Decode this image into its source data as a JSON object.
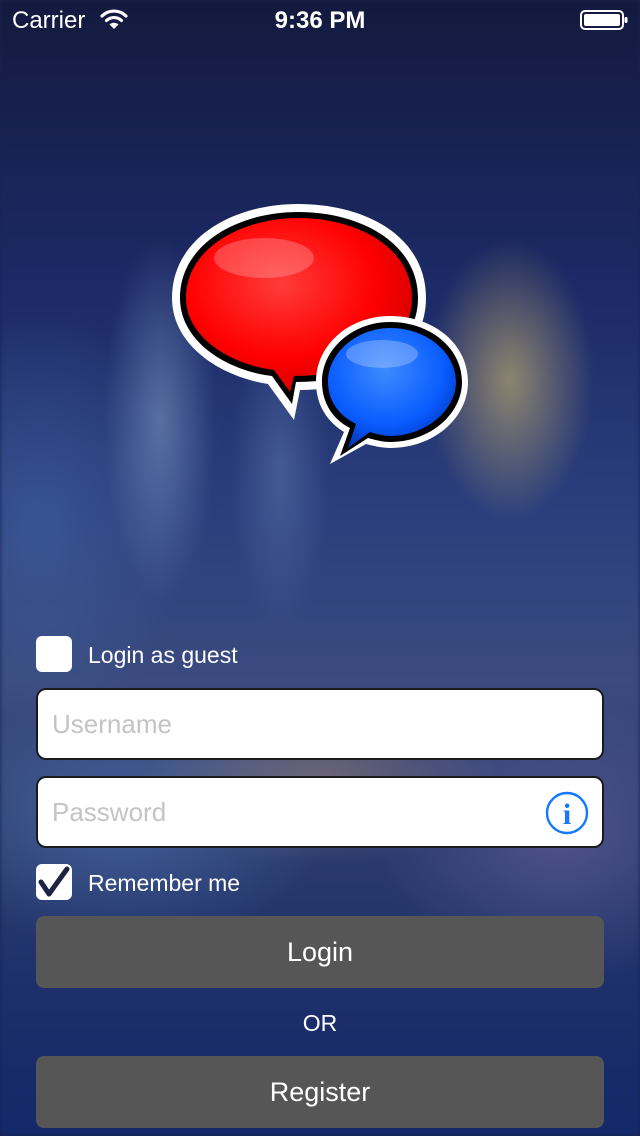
{
  "status_bar": {
    "carrier": "Carrier",
    "time": "9:36 PM",
    "wifi_icon": "wifi-icon",
    "battery_icon": "battery-icon"
  },
  "logo": {
    "icon": "chat-bubbles-icon",
    "colors": {
      "red_bubble": "#ff0000",
      "blue_bubble": "#0a5cff"
    }
  },
  "guest": {
    "label": "Login as guest",
    "checked": false
  },
  "username": {
    "value": "",
    "placeholder": "Username"
  },
  "password": {
    "value": "",
    "placeholder": "Password",
    "info_icon": "info-icon",
    "info_color": "#1479ff"
  },
  "remember": {
    "label": "Remember me",
    "checked": true
  },
  "buttons": {
    "login": "Login",
    "separator": "OR",
    "register": "Register"
  }
}
